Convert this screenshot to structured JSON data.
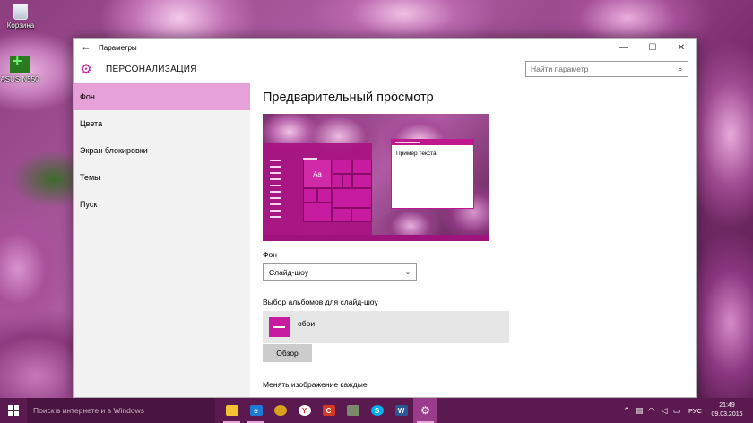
{
  "desktop": {
    "icons": [
      {
        "label": "Корзина",
        "icon": "recycle-bin-icon"
      },
      {
        "label": "ASUS N550",
        "icon": "asus-app-icon"
      }
    ]
  },
  "window": {
    "title": "Параметры",
    "back_icon": "←",
    "minimize": "—",
    "maximize": "☐",
    "close": "✕",
    "header_title": "ПЕРСОНАЛИЗАЦИЯ",
    "header_icon": "⚙",
    "search_placeholder": "Найти параметр",
    "search_icon": "⌕"
  },
  "sidebar": {
    "items": [
      {
        "label": "Фон",
        "active": true
      },
      {
        "label": "Цвета"
      },
      {
        "label": "Экран блокировки"
      },
      {
        "label": "Темы"
      },
      {
        "label": "Пуск"
      }
    ]
  },
  "content": {
    "title": "Предварительный просмотр",
    "preview": {
      "tile_label": "Aa",
      "window_text": "Пример текста"
    },
    "background_label": "Фон",
    "background_value": "Слайд-шоу",
    "chevron": "⌄",
    "albums_label": "Выбор альбомов для слайд-шоу",
    "album_name": "обои",
    "browse_button": "Обзор",
    "interval_label": "Менять изображение каждые"
  },
  "taskbar": {
    "search_placeholder": "Поиск в интернете и в Windows",
    "tray_lang": "РУС",
    "time": "21:49",
    "date": "09.03.2016",
    "accent": "#9b3b8b"
  },
  "colors": {
    "accent": "#c7239b",
    "sidebar_active": "#e6a2d8",
    "taskbar_bg": "#5b1a4f"
  }
}
